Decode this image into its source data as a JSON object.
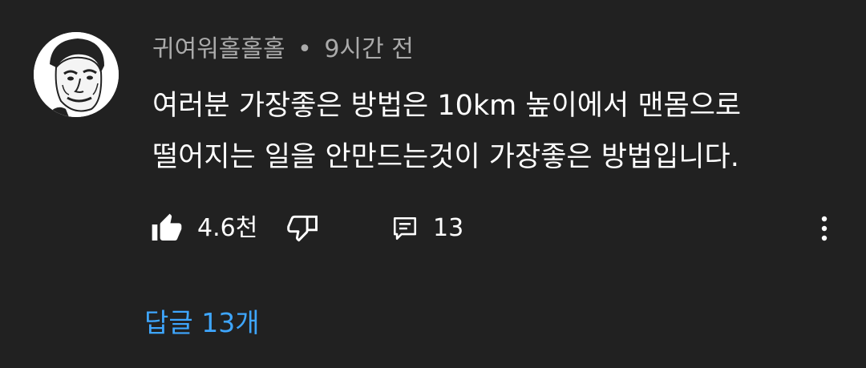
{
  "comment": {
    "author": "귀여워홀홀홀",
    "separator": "•",
    "time_ago": "9시간 전",
    "text": "여러분 가장좋은 방법은 10km 높이에서 맨몸으로\n떨어지는 일을 안만드는것이 가장좋은 방법입니다.",
    "like_count": "4.6천",
    "reply_count": "13",
    "replies_link": "답글 13개",
    "icons": {
      "like": "thumbs-up-icon",
      "dislike": "thumbs-down-icon",
      "reply": "reply-icon",
      "more": "more-vert-icon"
    }
  },
  "colors": {
    "background": "#212121",
    "meta_text": "#aaaaaa",
    "body_text": "#ffffff",
    "link": "#3ea6ff"
  }
}
